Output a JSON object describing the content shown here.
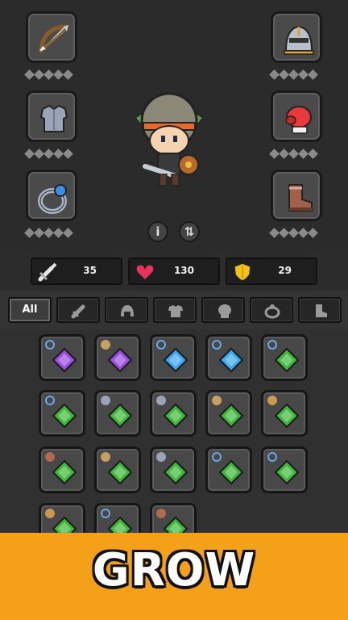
{
  "stats": {
    "attack": "35",
    "health": "130",
    "defense": "29"
  },
  "filters": {
    "all_label": "All"
  },
  "banner": {
    "title": "GROW"
  },
  "equipment": {
    "left": [
      "bow-icon",
      "chest-armor-icon",
      "ring-icon"
    ],
    "right": [
      "knight-helmet-icon",
      "boxing-glove-icon",
      "boot-icon"
    ]
  },
  "inventory": [
    {
      "gem": "purple",
      "tag": "ring"
    },
    {
      "gem": "purple",
      "tag": "helmet"
    },
    {
      "gem": "blue",
      "tag": "ring"
    },
    {
      "gem": "blue",
      "tag": "ring"
    },
    {
      "gem": "green",
      "tag": "ring"
    },
    {
      "gem": "green",
      "tag": "ring"
    },
    {
      "gem": "green",
      "tag": "armor"
    },
    {
      "gem": "green",
      "tag": "armor"
    },
    {
      "gem": "green",
      "tag": "helmet"
    },
    {
      "gem": "green",
      "tag": "bow"
    },
    {
      "gem": "green",
      "tag": "boot"
    },
    {
      "gem": "green",
      "tag": "helmet"
    },
    {
      "gem": "green",
      "tag": "armor"
    },
    {
      "gem": "green",
      "tag": "ring"
    },
    {
      "gem": "green",
      "tag": "ring"
    },
    {
      "gem": "green",
      "tag": "bow"
    },
    {
      "gem": "green",
      "tag": "ring"
    },
    {
      "gem": "green",
      "tag": "boot"
    }
  ],
  "colors": {
    "purple": "#9b4de0",
    "blue": "#3ea8f0",
    "green": "#3fb83a",
    "banner": "#f4a019",
    "heart": "#e8345a",
    "shield": "#f2c21b"
  }
}
